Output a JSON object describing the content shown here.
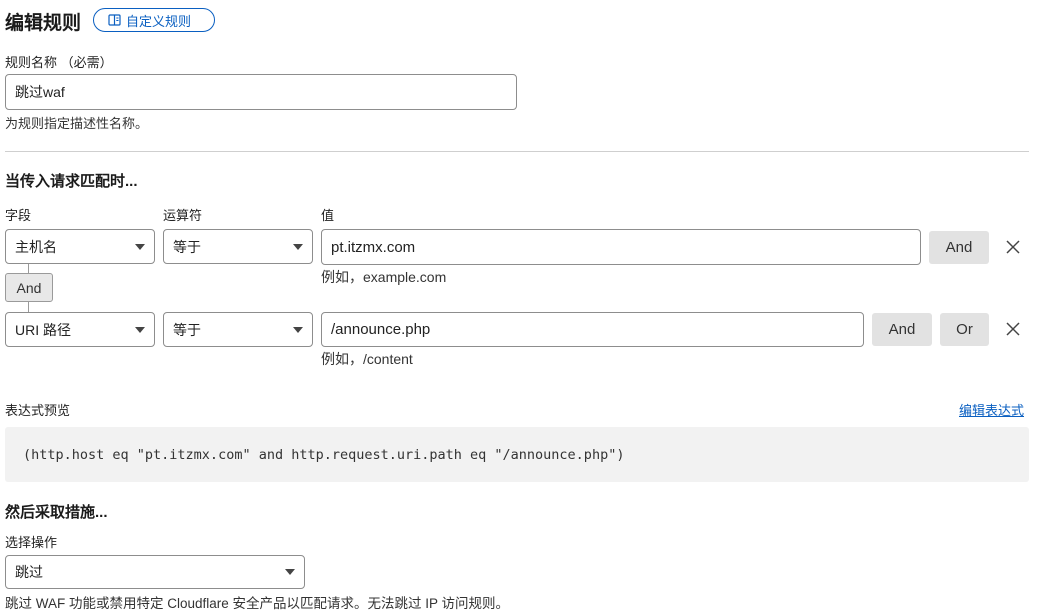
{
  "header": {
    "title": "编辑规则",
    "custom_rule_link": "自定义规则"
  },
  "rule_name": {
    "label": "规则名称 （必需）",
    "value": "跳过waf",
    "help": "为规则指定描述性名称。"
  },
  "match": {
    "title": "当传入请求匹配时...",
    "col_field": "字段",
    "col_operator": "运算符",
    "col_value": "值",
    "conditions": [
      {
        "field": "主机名",
        "operator": "等于",
        "value": "pt.itzmx.com",
        "hint": "例如，example.com",
        "buttons": [
          "And"
        ]
      },
      {
        "field": "URI 路径",
        "operator": "等于",
        "value": "/announce.php",
        "hint": "例如，/content",
        "buttons": [
          "And",
          "Or"
        ]
      }
    ],
    "joiner": "And"
  },
  "expression": {
    "label": "表达式预览",
    "edit_link": "编辑表达式",
    "preview": "(http.host eq \"pt.itzmx.com\" and http.request.uri.path eq \"/announce.php\")"
  },
  "action": {
    "title": "然后采取措施...",
    "label": "选择操作",
    "selected": "跳过",
    "help": "跳过 WAF 功能或禁用特定 Cloudflare 安全产品以匹配请求。无法跳过 IP 访问规则。"
  },
  "icons": {
    "book": "book-icon",
    "close": "close-icon",
    "dropdown": "chevron-down-icon"
  }
}
